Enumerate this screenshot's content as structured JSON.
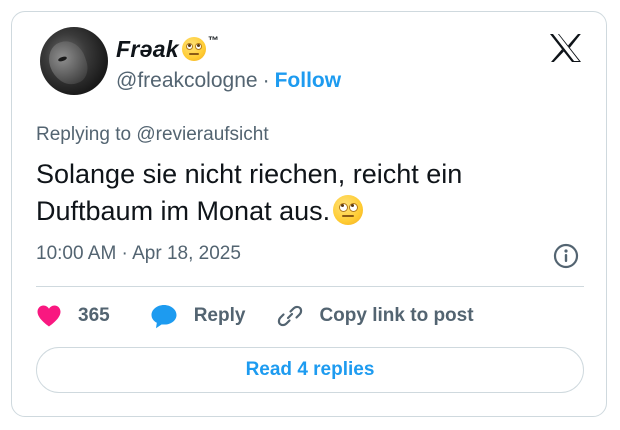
{
  "author": {
    "display_name": "Frǝak",
    "trademark": "™",
    "handle": "@freakcologne",
    "separator": "·",
    "follow_label": "Follow"
  },
  "tweet": {
    "reply_to": "Replying to @revieraufsicht",
    "text_line1": "Solange sie nicht riechen, reicht ein",
    "text_line2": "Duftbaum im Monat aus.",
    "timestamp": "10:00 AM · Apr 18, 2025"
  },
  "actions": {
    "like_count": "365",
    "reply_label": "Reply",
    "copy_link_label": "Copy link to post"
  },
  "read_replies_label": "Read 4 replies",
  "icons": [
    "x-logo-icon",
    "face-with-rolling-eyes-icon",
    "info-icon",
    "heart-icon",
    "reply-bubble-icon",
    "link-icon"
  ],
  "colors": {
    "accent": "#1d9bf0",
    "like": "#f91880",
    "secondary_text": "#536471",
    "border": "#cfd9de"
  }
}
